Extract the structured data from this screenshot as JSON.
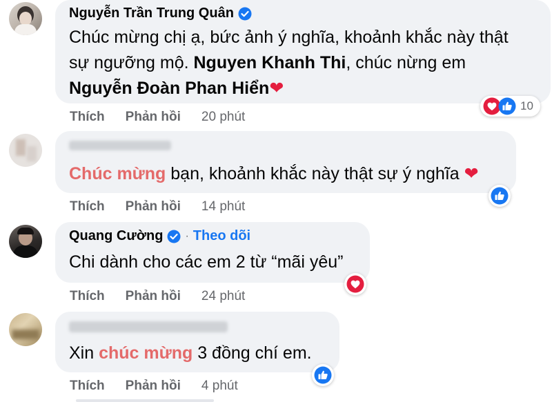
{
  "comments": [
    {
      "author": "Nguyễn Trần Trung Quân",
      "verified": true,
      "text_lines": [
        [
          {
            "t": "Chúc mừng chị ạ, bức ảnh ý nghĩa, khoảnh khắc này thật",
            "s": "normal"
          }
        ],
        [
          {
            "t": "sự ngưỡng mộ. ",
            "s": "normal"
          },
          {
            "t": "Nguyen Khanh Thi",
            "s": "bold"
          },
          {
            "t": ", chúc nừng em",
            "s": "normal"
          }
        ],
        [
          {
            "t": "Nguyễn Đoàn Phan Hiển",
            "s": "bold"
          },
          {
            "t": "❤",
            "s": "heart"
          }
        ]
      ],
      "actions": {
        "like": "Thích",
        "reply": "Phản hồi",
        "time": "20 phút"
      },
      "reactions": {
        "icons": [
          "love",
          "like"
        ],
        "count": "10"
      }
    },
    {
      "author": "",
      "author_hidden": true,
      "text_lines": [
        [
          {
            "t": "Chúc mừng",
            "s": "hl"
          },
          {
            "t": " bạn, khoảnh khắc này thật sự ý nghĩa ",
            "s": "normal"
          },
          {
            "t": "❤",
            "s": "heart"
          }
        ]
      ],
      "actions": {
        "like": "Thích",
        "reply": "Phản hồi",
        "time": "14 phút"
      },
      "reactions": {
        "icons": [
          "like"
        ],
        "count": ""
      }
    },
    {
      "author": "Quang Cường",
      "verified": true,
      "follow": "Theo dõi",
      "follow_sep": "·",
      "text_lines": [
        [
          {
            "t": "Chi dành cho các em 2 từ “mãi yêu”",
            "s": "normal"
          }
        ]
      ],
      "actions": {
        "like": "Thích",
        "reply": "Phản hồi",
        "time": "24 phút"
      },
      "reactions": {
        "icons": [
          "love"
        ],
        "count": ""
      }
    },
    {
      "author": "",
      "author_hidden": true,
      "text_lines": [
        [
          {
            "t": "Xin ",
            "s": "normal"
          },
          {
            "t": "chúc mừng",
            "s": "hl"
          },
          {
            "t": " 3 đồng chí em.",
            "s": "normal"
          }
        ]
      ],
      "actions": {
        "like": "Thích",
        "reply": "Phản hồi",
        "time": "4 phút"
      },
      "reactions": {
        "icons": [
          "like"
        ],
        "count": ""
      }
    }
  ],
  "colors": {
    "bubble": "#f0f2f5",
    "highlight": "#e46a6a",
    "link_blue": "#1877f2",
    "heart_red": "#e41e3f",
    "muted": "#65676b"
  }
}
